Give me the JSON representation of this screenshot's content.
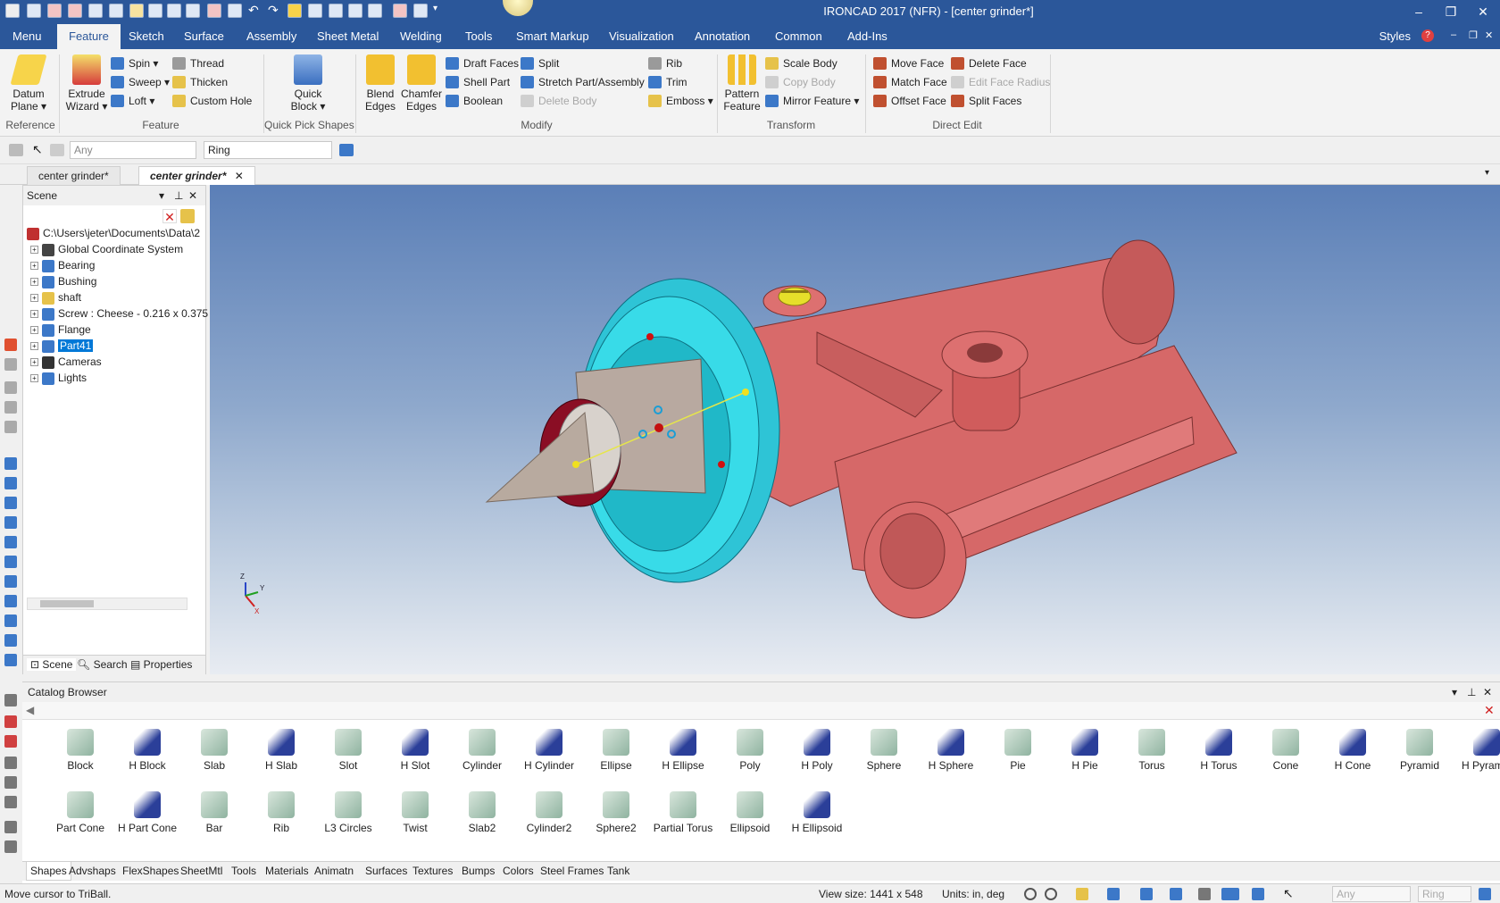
{
  "app_title": "IRONCAD 2017 (NFR) - [center grinder*]",
  "menu_tabs": [
    "Menu",
    "Feature",
    "Sketch",
    "Surface",
    "Assembly",
    "Sheet Metal",
    "Welding",
    "Tools",
    "Smart Markup",
    "Visualization",
    "Annotation",
    "Common",
    "Add-Ins"
  ],
  "active_menu": "Feature",
  "styles_label": "Styles",
  "ribbon": {
    "reference": {
      "label": "Reference",
      "datum_plane": "Datum Plane"
    },
    "feature": {
      "label": "Feature",
      "extrude_wizard": "Extrude Wizard",
      "spin": "Spin",
      "sweep": "Sweep",
      "loft": "Loft",
      "thread": "Thread",
      "thicken": "Thicken",
      "custom_hole": "Custom Hole"
    },
    "quick_pick": {
      "label": "Quick Pick Shapes",
      "quick_block": "Quick Block"
    },
    "modify": {
      "label": "Modify",
      "blend_edges": "Blend Edges",
      "chamfer_edges": "Chamfer Edges",
      "draft_faces": "Draft Faces",
      "shell_part": "Shell Part",
      "boolean": "Boolean",
      "split": "Split",
      "stretch": "Stretch Part/Assembly",
      "delete_body": "Delete Body",
      "rib": "Rib",
      "trim": "Trim",
      "emboss": "Emboss"
    },
    "transform": {
      "label": "Transform",
      "pattern_feature": "Pattern Feature",
      "scale_body": "Scale Body",
      "copy_body": "Copy Body",
      "mirror_feature": "Mirror Feature"
    },
    "direct_edit": {
      "label": "Direct Edit",
      "move_face": "Move Face",
      "match_face": "Match Face",
      "offset_face": "Offset Face",
      "delete_face": "Delete Face",
      "edit_face_radius": "Edit Face Radius",
      "split_faces": "Split Faces"
    }
  },
  "filter": {
    "selection": "Any",
    "ring": "Ring"
  },
  "doc_tabs": [
    "center grinder*",
    "center grinder*"
  ],
  "scene": {
    "title": "Scene",
    "root": "C:\\Users\\jeter\\Documents\\Data\\2",
    "items": [
      "Global Coordinate System",
      "Bearing",
      "Bushing",
      "shaft",
      "Screw : Cheese - 0.216 x 0.375",
      "Flange",
      "Part41",
      "Cameras",
      "Lights"
    ],
    "selected": "Part41",
    "tabs": [
      "Scene",
      "Search",
      "Properties"
    ]
  },
  "catalog": {
    "title": "Catalog Browser",
    "shapes_row1": [
      "Block",
      "H Block",
      "Slab",
      "H Slab",
      "Slot",
      "H Slot",
      "Cylinder",
      "H Cylinder",
      "Ellipse",
      "H Ellipse",
      "Poly",
      "H Poly",
      "Sphere",
      "H Sphere",
      "Pie",
      "H Pie",
      "Torus",
      "H Torus",
      "Cone",
      "H Cone",
      "Pyramid",
      "H Pyramid"
    ],
    "shapes_row2": [
      "Part Cone",
      "H Part Cone",
      "Bar",
      "Rib",
      "L3 Circles",
      "Twist",
      "Slab2",
      "Cylinder2",
      "Sphere2",
      "Partial Torus",
      "Ellipsoid",
      "H Ellipsoid"
    ],
    "tabs": [
      "Shapes",
      "Advshaps",
      "FlexShapes",
      "SheetMtl",
      "Tools",
      "Materials",
      "Animatn",
      "Surfaces",
      "Textures",
      "Bumps",
      "Colors",
      "Steel Frames",
      "Tank"
    ]
  },
  "axis": {
    "z": "Z",
    "y": "Y",
    "x": "X"
  },
  "status": {
    "message": "Move cursor to TriBall.",
    "view_size": "View size: 1441 x 548",
    "units": "Units: in, deg",
    "sel_any": "Any",
    "sel_ring": "Ring"
  }
}
